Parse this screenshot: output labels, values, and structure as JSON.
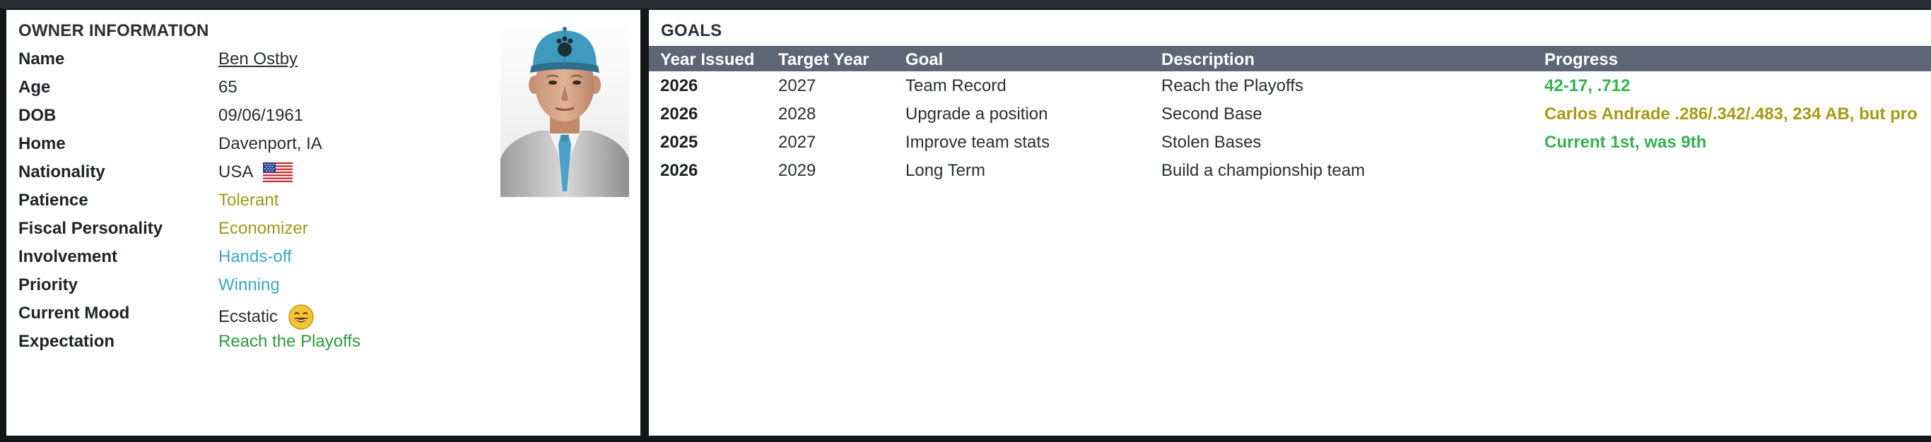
{
  "owner": {
    "title": "OWNER INFORMATION",
    "fields": [
      {
        "label": "Name",
        "value": "Ben Ostby"
      },
      {
        "label": "Age",
        "value": "65"
      },
      {
        "label": "DOB",
        "value": "09/06/1961"
      },
      {
        "label": "Home",
        "value": "Davenport, IA"
      },
      {
        "label": "Nationality",
        "value": "USA"
      },
      {
        "label": "Patience",
        "value": "Tolerant"
      },
      {
        "label": "Fiscal Personality",
        "value": "Economizer"
      },
      {
        "label": "Involvement",
        "value": "Hands-off"
      },
      {
        "label": "Priority",
        "value": "Winning"
      },
      {
        "label": "Current Mood",
        "value": "Ecstatic"
      },
      {
        "label": "Expectation",
        "value": "Reach the Playoffs"
      }
    ],
    "icons": {
      "flag": "usa-flag-icon",
      "mood": "ecstatic-face-icon",
      "portrait": "owner-portrait"
    }
  },
  "goals": {
    "title": "GOALS",
    "columns": [
      "Year Issued",
      "Target Year",
      "Goal",
      "Description",
      "Progress"
    ],
    "rows": [
      {
        "year_issued": "2026",
        "target_year": "2027",
        "goal": "Team Record",
        "description": "Reach the Playoffs",
        "progress": "42-17, .712"
      },
      {
        "year_issued": "2026",
        "target_year": "2028",
        "goal": "Upgrade a position",
        "description": "Second Base",
        "progress": "Carlos Andrade .286/.342/.483, 234 AB, but pro"
      },
      {
        "year_issued": "2025",
        "target_year": "2027",
        "goal": "Improve team stats",
        "description": "Stolen Bases",
        "progress": "Current 1st, was 9th"
      },
      {
        "year_issued": "2026",
        "target_year": "2029",
        "goal": "Long Term",
        "description": "Build a championship team",
        "progress": ""
      }
    ]
  },
  "colors": {
    "header_bar": "#5c6675",
    "olive": "#9a9c18",
    "blue": "#3aa7c8",
    "green": "#2e9b3a",
    "progress_green": "#35b152",
    "progress_olive": "#a89a12",
    "background": "#141618"
  }
}
